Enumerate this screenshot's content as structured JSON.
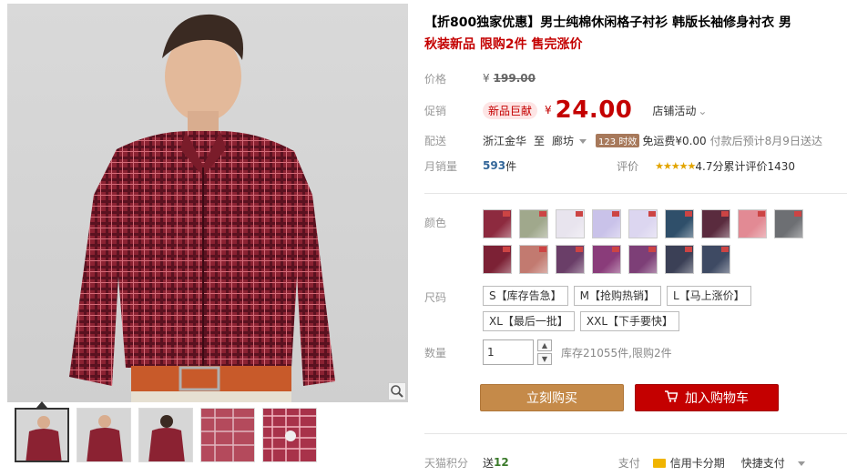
{
  "product": {
    "title": "【折800独家优惠】男士纯棉休闲格子衬衫 韩版长袖修身衬衣 男",
    "subtitle": "秋装新品 限购2件 售完涨价"
  },
  "price": {
    "label": "价格",
    "currency": "¥",
    "original": "199.00"
  },
  "promo": {
    "label": "促销",
    "tag": "新品巨献",
    "currency": "¥",
    "price": "24.00",
    "shop_activity": "店铺活动"
  },
  "delivery": {
    "label": "配送",
    "from": "浙江金华",
    "to_word": "至",
    "to": "廊坊",
    "badge": "123 时效",
    "fee": "免运费¥0.00",
    "note": "付款后预计8月9日送达"
  },
  "sales": {
    "label": "月销量",
    "count": "593",
    "unit": "件",
    "review_label": "评价",
    "stars": "★★★★★",
    "score": "4.7分",
    "review_text": "累计评价1430"
  },
  "colors": {
    "label": "颜色",
    "swatches": [
      "#8d2a3f",
      "#a0a88c",
      "#e8e4ee",
      "#c9c2e9",
      "#dcd6f0",
      "#2f4f6a",
      "#5a2b3e",
      "#e28a94",
      "#6d6f73",
      "#7c2135",
      "#c27a70",
      "#6a3e68",
      "#8a3c7a",
      "#7d3f77",
      "#3b4056",
      "#3e4a63"
    ]
  },
  "sizes": {
    "label": "尺码",
    "options": [
      "S【库存告急】",
      "M【抢购热销】",
      "L【马上涨价】",
      "XL【最后一批】",
      "XXL【下手要快】"
    ]
  },
  "quantity": {
    "label": "数量",
    "value": "1",
    "stock": "库存21055件,限购2件"
  },
  "buttons": {
    "buy": "立刻购买",
    "cart": "加入购物车"
  },
  "footer": {
    "points_label": "天猫积分",
    "points_prefix": "送",
    "points": "12",
    "pay_label": "支付",
    "credit": "信用卡分期",
    "quick": "快捷支付"
  }
}
